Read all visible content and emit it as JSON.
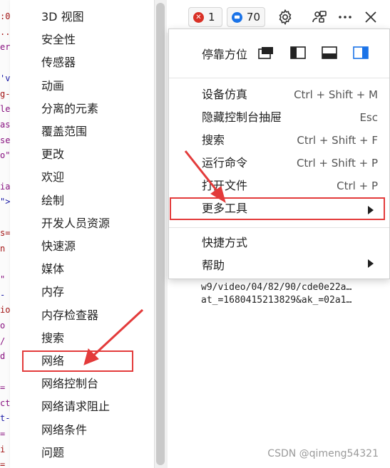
{
  "left_submenu": {
    "items": [
      "3D 视图",
      "安全性",
      "传感器",
      "动画",
      "分离的元素",
      "覆盖范围",
      "更改",
      "欢迎",
      "绘制",
      "开发人员资源",
      "快速源",
      "媒体",
      "内存",
      "内存检查器",
      "搜索",
      "网络",
      "网络控制台",
      "网络请求阻止",
      "网络条件",
      "问题"
    ]
  },
  "code_strip_chars": [
    ":0",
    "..",
    "er",
    "",
    "'v",
    "g-",
    "le",
    "as",
    "se",
    "o\"",
    "",
    "ia",
    "\">",
    "",
    "s=",
    "n",
    "",
    "\"",
    "-",
    "io",
    "o",
    "/",
    "d",
    "",
    "=",
    "ct",
    "t-",
    "=",
    "i",
    "="
  ],
  "toolbar": {
    "errors_count": "1",
    "messages_count": "70",
    "error_color": "#d93025",
    "message_color": "#1a73e8"
  },
  "menu": {
    "dock_label": "停靠方位",
    "items": [
      {
        "label": "设备仿真",
        "shortcut": "Ctrl + Shift + M"
      },
      {
        "label": "隐藏控制台抽屉",
        "shortcut": "Esc"
      },
      {
        "label": "搜索",
        "shortcut": "Ctrl + Shift + F"
      },
      {
        "label": "运行命令",
        "shortcut": "Ctrl + Shift + P"
      },
      {
        "label": "打开文件",
        "shortcut": "Ctrl + P"
      },
      {
        "label": "更多工具",
        "shortcut": ""
      }
    ],
    "items2": [
      {
        "label": "快捷方式"
      },
      {
        "label": "帮助"
      }
    ]
  },
  "background_text": {
    "line1": "w9/video/04/82/90/cde0e22a…",
    "line2": "at_=1680415213829&ak_=02a1…"
  },
  "watermark": "CSDN @qimeng54321",
  "annotation_color": "#e33b3b"
}
